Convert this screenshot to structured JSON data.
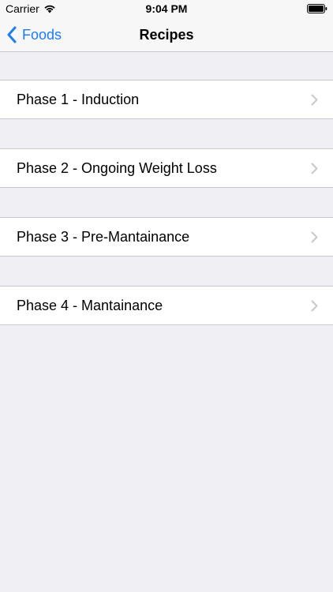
{
  "status_bar": {
    "carrier": "Carrier",
    "time": "9:04 PM",
    "wifi_icon": "wifi-icon",
    "battery_icon": "battery-full-icon"
  },
  "nav": {
    "back_label": "Foods",
    "title": "Recipes",
    "accent_color": "#1f7cf6"
  },
  "list": {
    "items": [
      {
        "label": "Phase 1 - Induction"
      },
      {
        "label": "Phase 2 - Ongoing Weight Loss"
      },
      {
        "label": "Phase 3 - Pre-Mantainance"
      },
      {
        "label": "Phase 4 - Mantainance"
      }
    ]
  }
}
